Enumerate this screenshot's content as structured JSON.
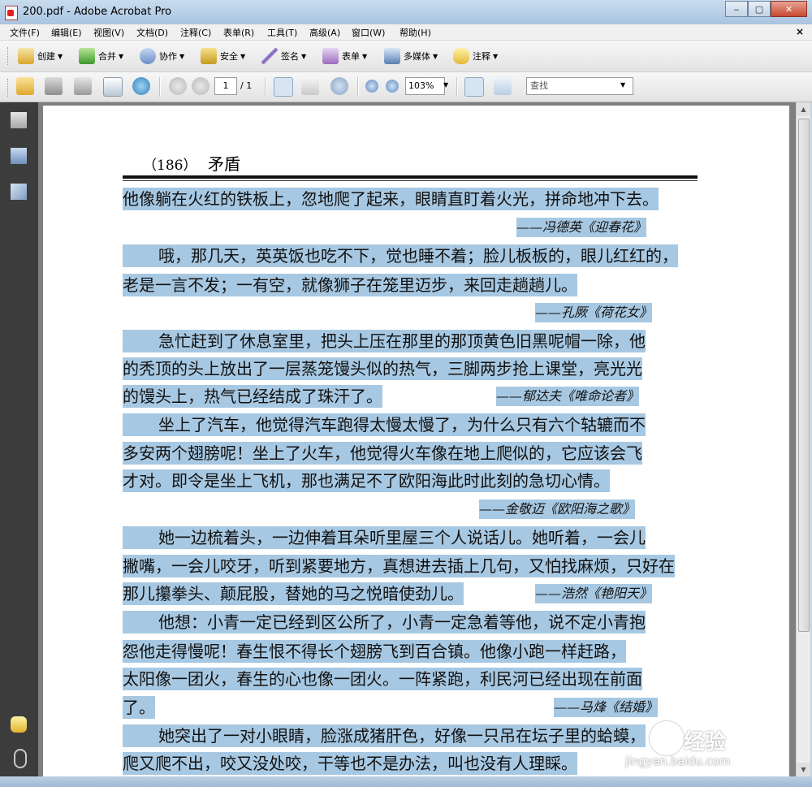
{
  "window": {
    "title": "200.pdf - Adobe Acrobat Pro",
    "minimize": "‒",
    "maximize": "▢",
    "close": "✕"
  },
  "menu": [
    "文件(F)",
    "编辑(E)",
    "视图(V)",
    "文档(D)",
    "注释(C)",
    "表单(R)",
    "工具(T)",
    "高级(A)",
    "窗口(W)",
    "帮助(H)"
  ],
  "menu_close": "×",
  "toolbar": {
    "create": "创建",
    "combine": "合并",
    "collaborate": "协作",
    "secure": "安全",
    "sign": "签名",
    "forms": "表单",
    "multimedia": "多媒体",
    "comment": "注释"
  },
  "nav": {
    "page_current": "1",
    "page_total": "/ 1",
    "zoom": "103%",
    "find_placeholder": "查找"
  },
  "page": {
    "header_num": "（186）",
    "header_title": "矛盾",
    "lines": [
      "他像躺在火红的铁板上，忽地爬了起来，眼睛直盯着火光，拼命地冲下去。",
      "哦，那几天，英英饭也吃不下，觉也睡不着；脸儿板板的，眼儿红红的，",
      "老是一言不发；一有空，就像狮子在笼里迈步，来回走趟趟儿。",
      "急忙赶到了休息室里，把头上压在那里的那顶黄色旧黑呢帽一除，他",
      "的秃顶的头上放出了一层蒸笼馒头似的热气，三脚两步抢上课堂，亮光光",
      "的馒头上，热气已经结成了珠汗了。",
      "坐上了汽车，他觉得汽车跑得太慢太慢了，为什么只有六个轱辘而不",
      "多安两个翅膀呢！坐上了火车，他觉得火车像在地上爬似的，它应该会飞",
      "才对。即令是坐上飞机，那也满足不了欧阳海此时此刻的急切心情。",
      "她一边梳着头，一边伸着耳朵听里屋三个人说话儿。她听着，一会儿",
      "撇嘴，一会儿咬牙，听到紧要地方，真想进去插上几句，又怕找麻烦，只好在",
      "那儿攥拳头、颠屁股，替她的马之悦暗使劲儿。",
      "他想：小青一定已经到区公所了，小青一定急着等他，说不定小青抱",
      "怨他走得慢呢！春生恨不得长个翅膀飞到百合镇。他像小跑一样赶路，",
      "太阳像一团火，春生的心也像一团火。一阵紧跑，利民河已经出现在前面",
      "了。",
      "她突出了一对小眼睛，脸涨成猪肝色，好像一只吊在坛子里的蛤蟆，",
      "爬又爬不出，咬又没处咬，干等也不是办法，叫也没有人理睬。"
    ],
    "sources": [
      "——冯德英《迎春花》",
      "——孔厥《荷花女》",
      "——郁达夫《唯命论者》",
      "——金敬迈《欧阳海之歌》",
      "——浩然《艳阳天》",
      "——马烽《结婚》"
    ]
  },
  "watermark": {
    "brand": "经验",
    "url": "jingyan.baidu.com"
  }
}
